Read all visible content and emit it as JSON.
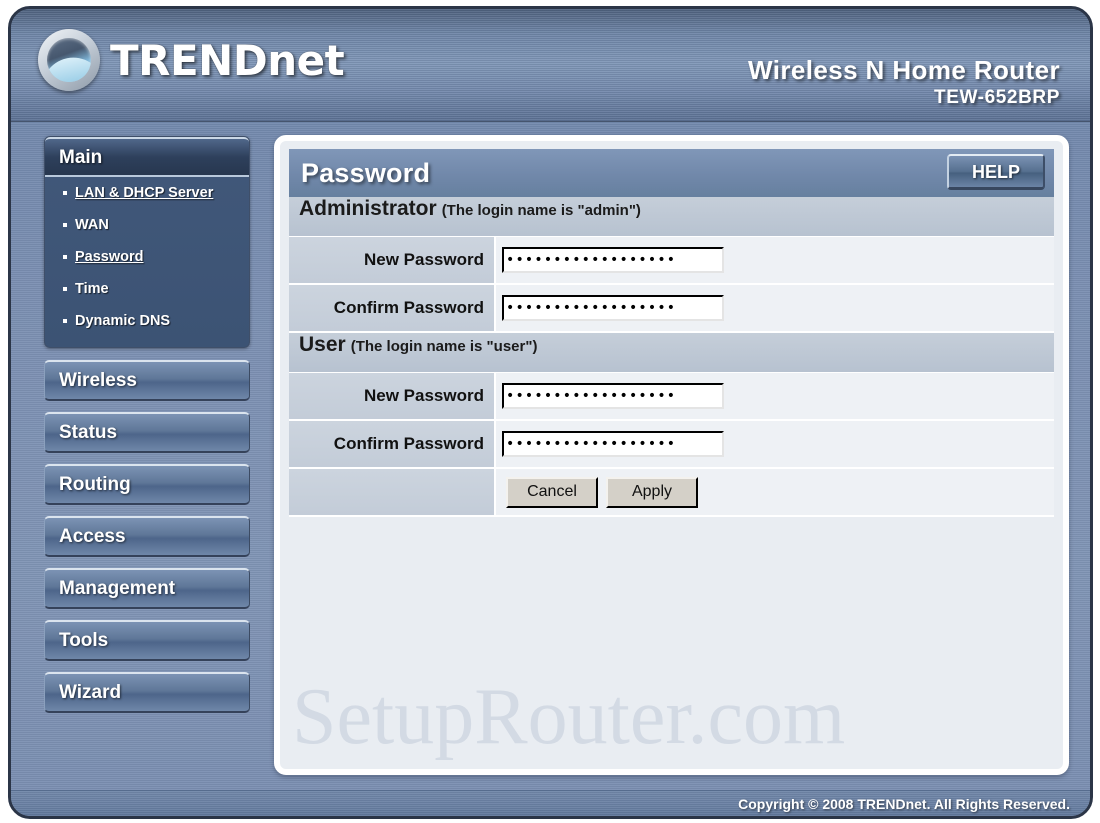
{
  "header": {
    "brand_upper": "TRENDN",
    "brand_lower": "et",
    "brand_full": "TRENDnet",
    "product_name": "Wireless N Home Router",
    "product_model": "TEW-652BRP"
  },
  "sidebar": {
    "main_group": {
      "label": "Main",
      "items": [
        {
          "label": "LAN & DHCP Server",
          "active": false
        },
        {
          "label": "WAN",
          "active": false
        },
        {
          "label": "Password",
          "active": true
        },
        {
          "label": "Time",
          "active": false
        },
        {
          "label": "Dynamic DNS",
          "active": false
        }
      ]
    },
    "buttons": [
      {
        "label": "Wireless"
      },
      {
        "label": "Status"
      },
      {
        "label": "Routing"
      },
      {
        "label": "Access"
      },
      {
        "label": "Management"
      },
      {
        "label": "Tools"
      },
      {
        "label": "Wizard"
      }
    ]
  },
  "content": {
    "page_title": "Password",
    "help_label": "HELP",
    "watermark": "SetupRouter.com",
    "sections": [
      {
        "title": "Administrator",
        "note": "(The login name is \"admin\")",
        "rows": [
          {
            "label": "New Password",
            "value": "••••••••••••••••••"
          },
          {
            "label": "Confirm Password",
            "value": "••••••••••••••••••"
          }
        ]
      },
      {
        "title": "User",
        "note": "(The login name is \"user\")",
        "rows": [
          {
            "label": "New Password",
            "value": "••••••••••••••••••"
          },
          {
            "label": "Confirm Password",
            "value": "••••••••••••••••••"
          }
        ]
      }
    ],
    "cancel_label": "Cancel",
    "apply_label": "Apply"
  },
  "footer": {
    "copyright": "Copyright © 2008 TRENDnet. All Rights Reserved."
  },
  "colors": {
    "accent_blue": "#6f86a8",
    "panel_bg": "#e9edf2",
    "nav_dark": "#2e405c",
    "label_cell": "#c7cfda"
  }
}
